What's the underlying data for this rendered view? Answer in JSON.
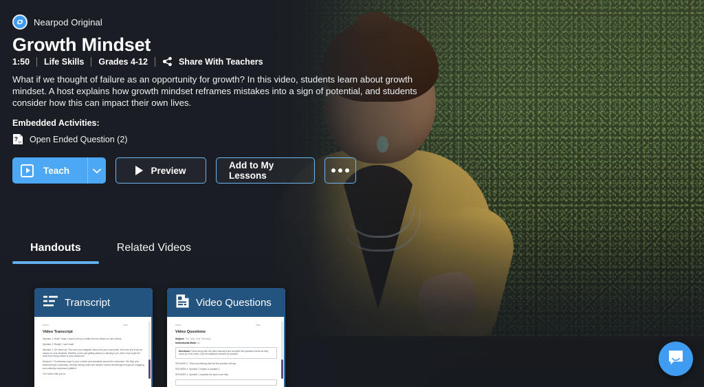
{
  "brand": {
    "logo_icon": "nearpod-logo-icon",
    "label": "Nearpod Original"
  },
  "lesson": {
    "title": "Growth Mindset",
    "duration": "1:50",
    "subject": "Life Skills",
    "grades": "Grades 4-12",
    "share_label": "Share With Teachers",
    "share_icon": "share-icon",
    "description": "What if we thought of failure as an opportunity for growth? In this video, students learn about growth mindset. A host explains how growth mindset reframes mistakes into a sign of potential, and students consider how this can impact their own lives."
  },
  "embedded": {
    "heading": "Embedded Activities:",
    "items": [
      {
        "icon": "question-document-icon",
        "label": "Open Ended Question (2)"
      }
    ]
  },
  "actions": {
    "teach_label": "Teach",
    "teach_play_icon": "play-box-icon",
    "teach_caret_icon": "chevron-down-icon",
    "preview_label": "Preview",
    "preview_icon": "play-icon",
    "add_label": "Add to My Lessons",
    "more_icon": "more-options-icon"
  },
  "tabs": [
    {
      "label": "Handouts",
      "active": true
    },
    {
      "label": "Related Videos",
      "active": false
    }
  ],
  "handouts": [
    {
      "icon": "transcript-lines-icon",
      "title": "Transcript",
      "doc": {
        "name_label": "Name",
        "date_label": "Date",
        "heading": "Video Transcript",
        "lines": [
          "Speaker 1: Hello! Today I want to tell you a little bit more about our new videos.",
          "Speaker 2: Really? I can't wait!",
          "Speaker 1: Ok, listen up! The more you integrate videos into your curriculum, the more you'll see an impact on your students. Whether you're just getting started or already a pro, learn how to get the most from using videos in your classroom.",
          "Nearpod + Flocabulary maps to your content and standards across the curriculum. We help your students build vocabulary, develop literacy skills and deepen content knowledge through an engaging and culturally responsive platform.",
          "Our videos help you to:"
        ]
      }
    },
    {
      "icon": "questions-document-icon",
      "title": "Video Questions",
      "doc": {
        "name_label": "Name",
        "date_label": "Date",
        "heading": "Video Questions",
        "subject_label": "Subject:",
        "subject_value": "The Topic Your Teaching",
        "mode_label": "Instructional Mode:",
        "mode_value": "All",
        "directions_label": "Directions:",
        "directions_value": "Follow along with the video transcript and complete the questions below as they come up in the video. Use the additional handout for practice.",
        "lines": [
          "SPEAKER 1: This is something that the first speaker will say.",
          "SPEAKER 2: Speaker 2 replies to speaker 1.",
          "SPEAKER 1: Speaker 1 explains the topic more fully."
        ]
      }
    }
  ],
  "chat": {
    "icon": "chat-bubble-icon",
    "label": "Open chat"
  },
  "colors": {
    "accent_blue": "#4ca7f4",
    "tab_underline": "#62afef",
    "card_header": "#235480",
    "page_bg": "#1a1e24",
    "button_border": "#6fb6f2"
  }
}
